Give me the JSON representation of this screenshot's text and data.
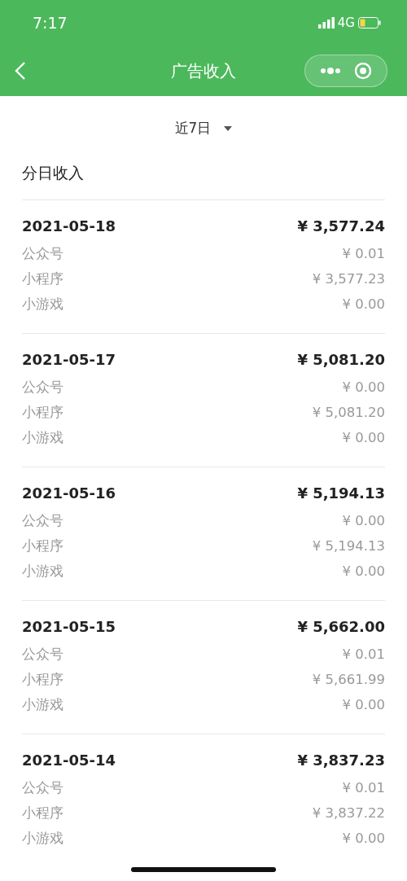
{
  "status_bar": {
    "time": "7:17",
    "network": "4G"
  },
  "nav": {
    "title": "广告收入"
  },
  "filter": {
    "label": "近7日"
  },
  "section_title": "分日收入",
  "days": [
    {
      "date": "2021-05-18",
      "total": "¥ 3,577.24",
      "rows": [
        {
          "label": "公众号",
          "value": "¥ 0.01"
        },
        {
          "label": "小程序",
          "value": "¥ 3,577.23"
        },
        {
          "label": "小游戏",
          "value": "¥ 0.00"
        }
      ]
    },
    {
      "date": "2021-05-17",
      "total": "¥ 5,081.20",
      "rows": [
        {
          "label": "公众号",
          "value": "¥ 0.00"
        },
        {
          "label": "小程序",
          "value": "¥ 5,081.20"
        },
        {
          "label": "小游戏",
          "value": "¥ 0.00"
        }
      ]
    },
    {
      "date": "2021-05-16",
      "total": "¥ 5,194.13",
      "rows": [
        {
          "label": "公众号",
          "value": "¥ 0.00"
        },
        {
          "label": "小程序",
          "value": "¥ 5,194.13"
        },
        {
          "label": "小游戏",
          "value": "¥ 0.00"
        }
      ]
    },
    {
      "date": "2021-05-15",
      "total": "¥ 5,662.00",
      "rows": [
        {
          "label": "公众号",
          "value": "¥ 0.01"
        },
        {
          "label": "小程序",
          "value": "¥ 5,661.99"
        },
        {
          "label": "小游戏",
          "value": "¥ 0.00"
        }
      ]
    },
    {
      "date": "2021-05-14",
      "total": "¥ 3,837.23",
      "rows": [
        {
          "label": "公众号",
          "value": "¥ 0.01"
        },
        {
          "label": "小程序",
          "value": "¥ 3,837.22"
        },
        {
          "label": "小游戏",
          "value": "¥ 0.00"
        }
      ]
    }
  ]
}
